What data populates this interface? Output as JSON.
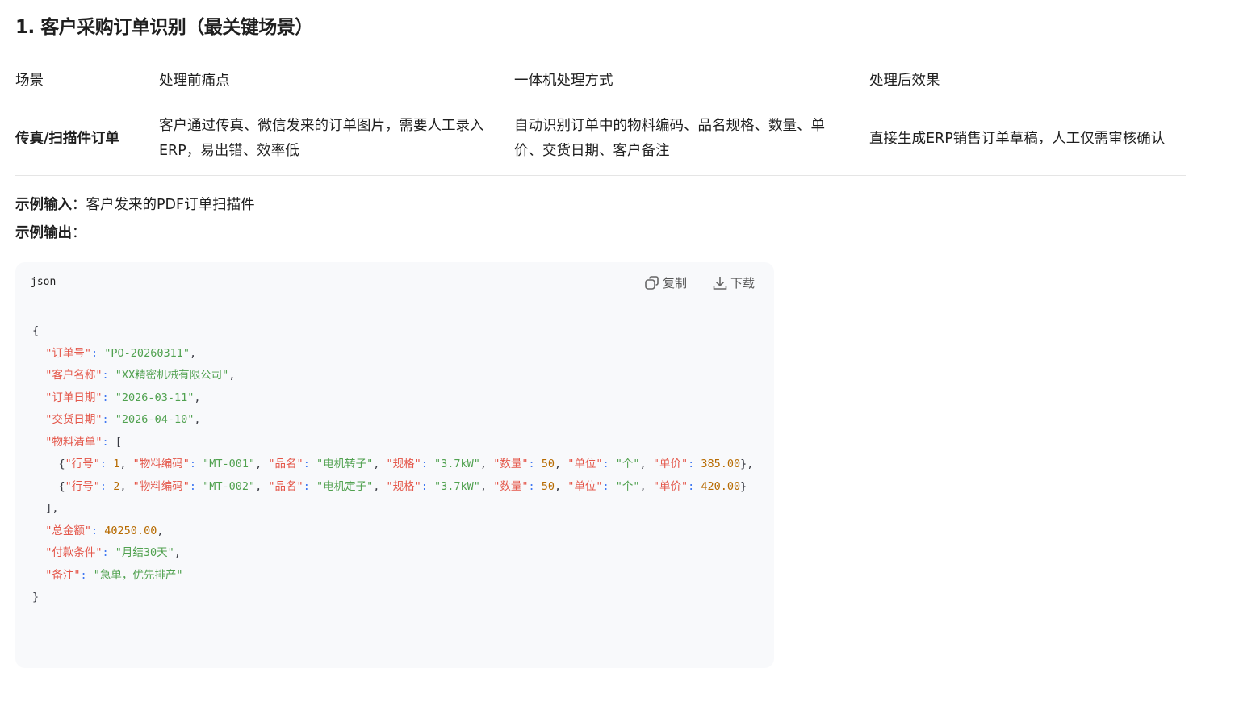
{
  "heading": "1. 客户采购订单识别（最关键场景）",
  "table": {
    "headers": [
      "场景",
      "处理前痛点",
      "一体机处理方式",
      "处理后效果"
    ],
    "rows": [
      [
        "传真/扫描件订单",
        "客户通过传真、微信发来的订单图片，需要人工录入ERP，易出错、效率低",
        "自动识别订单中的物料编码、品名规格、数量、单价、交货日期、客户备注",
        "直接生成ERP销售订单草稿，人工仅需审核确认"
      ]
    ]
  },
  "example_input": {
    "label": "示例输入",
    "sep": "：",
    "value": "客户发来的PDF订单扫描件"
  },
  "example_output": {
    "label": "示例输出",
    "sep": "："
  },
  "code": {
    "language": "json",
    "copy_label": "复制",
    "download_label": "下载",
    "lines": [
      [
        [
          "o",
          "{"
        ]
      ],
      [
        [
          "o",
          "  "
        ],
        [
          "k",
          "\"订单号\""
        ],
        [
          "p",
          ": "
        ],
        [
          "s",
          "\"PO-20260311\""
        ],
        [
          "o",
          ","
        ]
      ],
      [
        [
          "o",
          "  "
        ],
        [
          "k",
          "\"客户名称\""
        ],
        [
          "p",
          ": "
        ],
        [
          "s",
          "\"XX精密机械有限公司\""
        ],
        [
          "o",
          ","
        ]
      ],
      [
        [
          "o",
          "  "
        ],
        [
          "k",
          "\"订单日期\""
        ],
        [
          "p",
          ": "
        ],
        [
          "s",
          "\"2026-03-11\""
        ],
        [
          "o",
          ","
        ]
      ],
      [
        [
          "o",
          "  "
        ],
        [
          "k",
          "\"交货日期\""
        ],
        [
          "p",
          ": "
        ],
        [
          "s",
          "\"2026-04-10\""
        ],
        [
          "o",
          ","
        ]
      ],
      [
        [
          "o",
          "  "
        ],
        [
          "k",
          "\"物料清单\""
        ],
        [
          "p",
          ": "
        ],
        [
          "o",
          "["
        ]
      ],
      [
        [
          "o",
          "    {"
        ],
        [
          "k",
          "\"行号\""
        ],
        [
          "p",
          ": "
        ],
        [
          "n",
          "1"
        ],
        [
          "o",
          ", "
        ],
        [
          "k",
          "\"物料编码\""
        ],
        [
          "p",
          ": "
        ],
        [
          "s",
          "\"MT-001\""
        ],
        [
          "o",
          ", "
        ],
        [
          "k",
          "\"品名\""
        ],
        [
          "p",
          ": "
        ],
        [
          "s",
          "\"电机转子\""
        ],
        [
          "o",
          ", "
        ],
        [
          "k",
          "\"规格\""
        ],
        [
          "p",
          ": "
        ],
        [
          "s",
          "\"3.7kW\""
        ],
        [
          "o",
          ", "
        ],
        [
          "k",
          "\"数量\""
        ],
        [
          "p",
          ": "
        ],
        [
          "n",
          "50"
        ],
        [
          "o",
          ", "
        ],
        [
          "k",
          "\"单位\""
        ],
        [
          "p",
          ": "
        ],
        [
          "s",
          "\"个\""
        ],
        [
          "o",
          ", "
        ],
        [
          "k",
          "\"单价\""
        ],
        [
          "p",
          ": "
        ],
        [
          "n",
          "385.00"
        ],
        [
          "o",
          "},"
        ]
      ],
      [
        [
          "o",
          "    {"
        ],
        [
          "k",
          "\"行号\""
        ],
        [
          "p",
          ": "
        ],
        [
          "n",
          "2"
        ],
        [
          "o",
          ", "
        ],
        [
          "k",
          "\"物料编码\""
        ],
        [
          "p",
          ": "
        ],
        [
          "s",
          "\"MT-002\""
        ],
        [
          "o",
          ", "
        ],
        [
          "k",
          "\"品名\""
        ],
        [
          "p",
          ": "
        ],
        [
          "s",
          "\"电机定子\""
        ],
        [
          "o",
          ", "
        ],
        [
          "k",
          "\"规格\""
        ],
        [
          "p",
          ": "
        ],
        [
          "s",
          "\"3.7kW\""
        ],
        [
          "o",
          ", "
        ],
        [
          "k",
          "\"数量\""
        ],
        [
          "p",
          ": "
        ],
        [
          "n",
          "50"
        ],
        [
          "o",
          ", "
        ],
        [
          "k",
          "\"单位\""
        ],
        [
          "p",
          ": "
        ],
        [
          "s",
          "\"个\""
        ],
        [
          "o",
          ", "
        ],
        [
          "k",
          "\"单价\""
        ],
        [
          "p",
          ": "
        ],
        [
          "n",
          "420.00"
        ],
        [
          "o",
          "}"
        ]
      ],
      [
        [
          "o",
          "  ],"
        ]
      ],
      [
        [
          "o",
          "  "
        ],
        [
          "k",
          "\"总金额\""
        ],
        [
          "p",
          ": "
        ],
        [
          "n",
          "40250.00"
        ],
        [
          "o",
          ","
        ]
      ],
      [
        [
          "o",
          "  "
        ],
        [
          "k",
          "\"付款条件\""
        ],
        [
          "p",
          ": "
        ],
        [
          "s",
          "\"月结30天\""
        ],
        [
          "o",
          ","
        ]
      ],
      [
        [
          "o",
          "  "
        ],
        [
          "k",
          "\"备注\""
        ],
        [
          "p",
          ": "
        ],
        [
          "s",
          "\"急单，优先排产\""
        ]
      ],
      [
        [
          "o",
          "}"
        ]
      ]
    ]
  }
}
